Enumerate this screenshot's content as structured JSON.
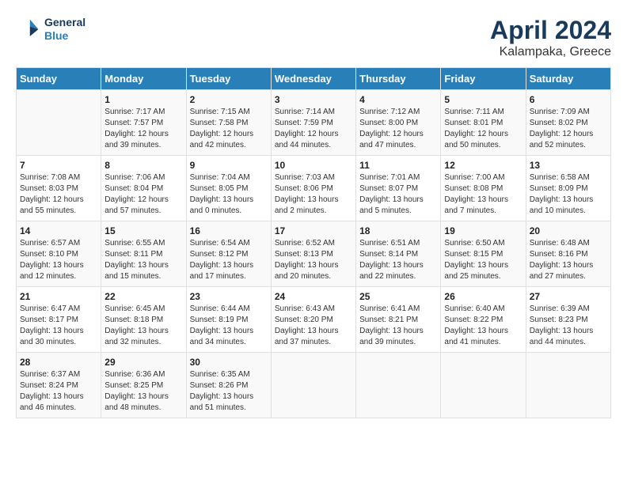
{
  "header": {
    "logo_line1": "General",
    "logo_line2": "Blue",
    "title": "April 2024",
    "subtitle": "Kalampaka, Greece"
  },
  "calendar": {
    "days_of_week": [
      "Sunday",
      "Monday",
      "Tuesday",
      "Wednesday",
      "Thursday",
      "Friday",
      "Saturday"
    ],
    "weeks": [
      [
        {
          "day": "",
          "info": ""
        },
        {
          "day": "1",
          "info": "Sunrise: 7:17 AM\nSunset: 7:57 PM\nDaylight: 12 hours\nand 39 minutes."
        },
        {
          "day": "2",
          "info": "Sunrise: 7:15 AM\nSunset: 7:58 PM\nDaylight: 12 hours\nand 42 minutes."
        },
        {
          "day": "3",
          "info": "Sunrise: 7:14 AM\nSunset: 7:59 PM\nDaylight: 12 hours\nand 44 minutes."
        },
        {
          "day": "4",
          "info": "Sunrise: 7:12 AM\nSunset: 8:00 PM\nDaylight: 12 hours\nand 47 minutes."
        },
        {
          "day": "5",
          "info": "Sunrise: 7:11 AM\nSunset: 8:01 PM\nDaylight: 12 hours\nand 50 minutes."
        },
        {
          "day": "6",
          "info": "Sunrise: 7:09 AM\nSunset: 8:02 PM\nDaylight: 12 hours\nand 52 minutes."
        }
      ],
      [
        {
          "day": "7",
          "info": "Sunrise: 7:08 AM\nSunset: 8:03 PM\nDaylight: 12 hours\nand 55 minutes."
        },
        {
          "day": "8",
          "info": "Sunrise: 7:06 AM\nSunset: 8:04 PM\nDaylight: 12 hours\nand 57 minutes."
        },
        {
          "day": "9",
          "info": "Sunrise: 7:04 AM\nSunset: 8:05 PM\nDaylight: 13 hours\nand 0 minutes."
        },
        {
          "day": "10",
          "info": "Sunrise: 7:03 AM\nSunset: 8:06 PM\nDaylight: 13 hours\nand 2 minutes."
        },
        {
          "day": "11",
          "info": "Sunrise: 7:01 AM\nSunset: 8:07 PM\nDaylight: 13 hours\nand 5 minutes."
        },
        {
          "day": "12",
          "info": "Sunrise: 7:00 AM\nSunset: 8:08 PM\nDaylight: 13 hours\nand 7 minutes."
        },
        {
          "day": "13",
          "info": "Sunrise: 6:58 AM\nSunset: 8:09 PM\nDaylight: 13 hours\nand 10 minutes."
        }
      ],
      [
        {
          "day": "14",
          "info": "Sunrise: 6:57 AM\nSunset: 8:10 PM\nDaylight: 13 hours\nand 12 minutes."
        },
        {
          "day": "15",
          "info": "Sunrise: 6:55 AM\nSunset: 8:11 PM\nDaylight: 13 hours\nand 15 minutes."
        },
        {
          "day": "16",
          "info": "Sunrise: 6:54 AM\nSunset: 8:12 PM\nDaylight: 13 hours\nand 17 minutes."
        },
        {
          "day": "17",
          "info": "Sunrise: 6:52 AM\nSunset: 8:13 PM\nDaylight: 13 hours\nand 20 minutes."
        },
        {
          "day": "18",
          "info": "Sunrise: 6:51 AM\nSunset: 8:14 PM\nDaylight: 13 hours\nand 22 minutes."
        },
        {
          "day": "19",
          "info": "Sunrise: 6:50 AM\nSunset: 8:15 PM\nDaylight: 13 hours\nand 25 minutes."
        },
        {
          "day": "20",
          "info": "Sunrise: 6:48 AM\nSunset: 8:16 PM\nDaylight: 13 hours\nand 27 minutes."
        }
      ],
      [
        {
          "day": "21",
          "info": "Sunrise: 6:47 AM\nSunset: 8:17 PM\nDaylight: 13 hours\nand 30 minutes."
        },
        {
          "day": "22",
          "info": "Sunrise: 6:45 AM\nSunset: 8:18 PM\nDaylight: 13 hours\nand 32 minutes."
        },
        {
          "day": "23",
          "info": "Sunrise: 6:44 AM\nSunset: 8:19 PM\nDaylight: 13 hours\nand 34 minutes."
        },
        {
          "day": "24",
          "info": "Sunrise: 6:43 AM\nSunset: 8:20 PM\nDaylight: 13 hours\nand 37 minutes."
        },
        {
          "day": "25",
          "info": "Sunrise: 6:41 AM\nSunset: 8:21 PM\nDaylight: 13 hours\nand 39 minutes."
        },
        {
          "day": "26",
          "info": "Sunrise: 6:40 AM\nSunset: 8:22 PM\nDaylight: 13 hours\nand 41 minutes."
        },
        {
          "day": "27",
          "info": "Sunrise: 6:39 AM\nSunset: 8:23 PM\nDaylight: 13 hours\nand 44 minutes."
        }
      ],
      [
        {
          "day": "28",
          "info": "Sunrise: 6:37 AM\nSunset: 8:24 PM\nDaylight: 13 hours\nand 46 minutes."
        },
        {
          "day": "29",
          "info": "Sunrise: 6:36 AM\nSunset: 8:25 PM\nDaylight: 13 hours\nand 48 minutes."
        },
        {
          "day": "30",
          "info": "Sunrise: 6:35 AM\nSunset: 8:26 PM\nDaylight: 13 hours\nand 51 minutes."
        },
        {
          "day": "",
          "info": ""
        },
        {
          "day": "",
          "info": ""
        },
        {
          "day": "",
          "info": ""
        },
        {
          "day": "",
          "info": ""
        }
      ]
    ]
  }
}
